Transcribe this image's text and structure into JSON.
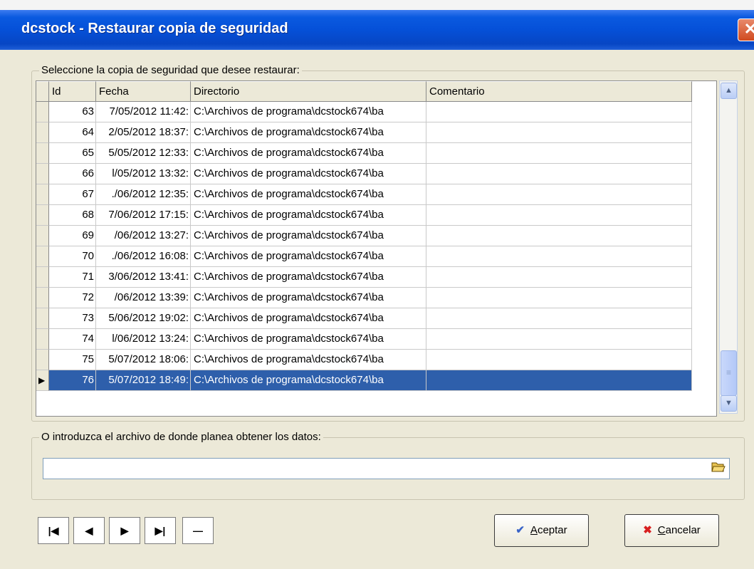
{
  "window": {
    "title": "dcstock - Restaurar copia de seguridad",
    "close_glyph": "✕"
  },
  "backup_group": {
    "label": "Seleccione la copia de seguridad que desee restaurar:"
  },
  "grid": {
    "columns": [
      "Id",
      "Fecha",
      "Directorio",
      "Comentario"
    ],
    "rows": [
      {
        "id": "63",
        "fecha": "7/05/2012 11:42:",
        "dir": "C:\\Archivos de programa\\dcstock674\\ba",
        "comentario": ""
      },
      {
        "id": "64",
        "fecha": "2/05/2012 18:37:",
        "dir": "C:\\Archivos de programa\\dcstock674\\ba",
        "comentario": ""
      },
      {
        "id": "65",
        "fecha": "5/05/2012 12:33:",
        "dir": "C:\\Archivos de programa\\dcstock674\\ba",
        "comentario": ""
      },
      {
        "id": "66",
        "fecha": "l/05/2012 13:32:",
        "dir": "C:\\Archivos de programa\\dcstock674\\ba",
        "comentario": ""
      },
      {
        "id": "67",
        "fecha": "./06/2012 12:35:",
        "dir": "C:\\Archivos de programa\\dcstock674\\ba",
        "comentario": ""
      },
      {
        "id": "68",
        "fecha": "7/06/2012 17:15:",
        "dir": "C:\\Archivos de programa\\dcstock674\\ba",
        "comentario": ""
      },
      {
        "id": "69",
        "fecha": "/06/2012 13:27:",
        "dir": "C:\\Archivos de programa\\dcstock674\\ba",
        "comentario": ""
      },
      {
        "id": "70",
        "fecha": "./06/2012 16:08:",
        "dir": "C:\\Archivos de programa\\dcstock674\\ba",
        "comentario": ""
      },
      {
        "id": "71",
        "fecha": "3/06/2012 13:41:",
        "dir": "C:\\Archivos de programa\\dcstock674\\ba",
        "comentario": ""
      },
      {
        "id": "72",
        "fecha": "/06/2012 13:39:",
        "dir": "C:\\Archivos de programa\\dcstock674\\ba",
        "comentario": ""
      },
      {
        "id": "73",
        "fecha": "5/06/2012 19:02:",
        "dir": "C:\\Archivos de programa\\dcstock674\\ba",
        "comentario": ""
      },
      {
        "id": "74",
        "fecha": "l/06/2012 13:24:",
        "dir": "C:\\Archivos de programa\\dcstock674\\ba",
        "comentario": ""
      },
      {
        "id": "75",
        "fecha": "5/07/2012 18:06:",
        "dir": "C:\\Archivos de programa\\dcstock674\\ba",
        "comentario": ""
      },
      {
        "id": "76",
        "fecha": "5/07/2012 18:49:",
        "dir": "C:\\Archivos de programa\\dcstock674\\ba",
        "comentario": ""
      }
    ],
    "selected_id": "76"
  },
  "file_group": {
    "label": "O introduzca el archivo de donde planea obtener los datos:",
    "value": "",
    "browse_icon": "folder-open-icon"
  },
  "nav": {
    "first": "|◀",
    "prev": "◀",
    "next": "▶",
    "last": "▶|",
    "delete": "—"
  },
  "buttons": {
    "accept_u": "A",
    "accept_rest": "ceptar",
    "cancel_u": "C",
    "cancel_rest": "ancelar"
  },
  "colors": {
    "title_bar": "#0550d8",
    "selection": "#2e5fab",
    "dialog_bg": "#ece9d8"
  }
}
